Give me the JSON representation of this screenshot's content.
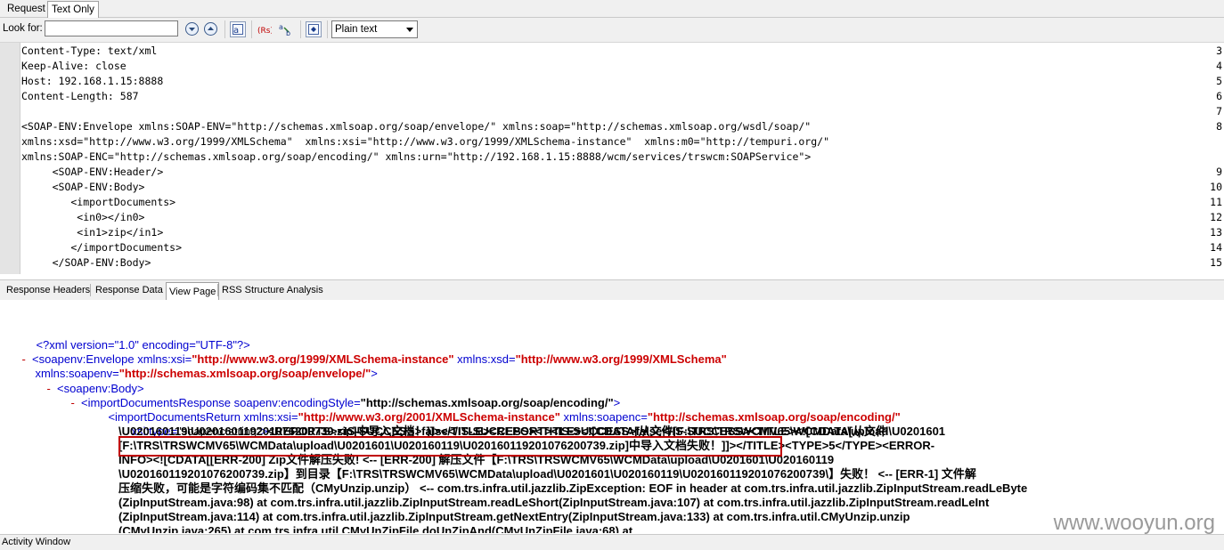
{
  "top_tabs": [
    "Request",
    "Text Only"
  ],
  "toolbar": {
    "look_for_label": "Look for:",
    "search_value": "",
    "search_placeholder": "",
    "format_selected": "Plain text"
  },
  "request_lines": [
    {
      "n": "3",
      "text": "Content-Type: text/xml"
    },
    {
      "n": "4",
      "text": "Keep-Alive: close"
    },
    {
      "n": "5",
      "text": "Host: 192.168.1.15:8888"
    },
    {
      "n": "6",
      "text": "Content-Length: 587"
    },
    {
      "n": "7",
      "text": ""
    },
    {
      "n": "8",
      "text": "<SOAP-ENV:Envelope xmlns:SOAP-ENV=\"http://schemas.xmlsoap.org/soap/envelope/\" xmlns:soap=\"http://schemas.xmlsoap.org/wsdl/soap/\""
    },
    {
      "n": "",
      "text": "xmlns:xsd=\"http://www.w3.org/1999/XMLSchema\"  xmlns:xsi=\"http://www.w3.org/1999/XMLSchema-instance\"  xmlns:m0=\"http://tempuri.org/\""
    },
    {
      "n": "",
      "text": "xmlns:SOAP-ENC=\"http://schemas.xmlsoap.org/soap/encoding/\" xmlns:urn=\"http://192.168.1.15:8888/wcm/services/trswcm:SOAPService\">"
    },
    {
      "n": "9",
      "text": "     <SOAP-ENV:Header/>"
    },
    {
      "n": "10",
      "text": "     <SOAP-ENV:Body>"
    },
    {
      "n": "11",
      "text": "        <importDocuments>"
    },
    {
      "n": "12",
      "text": "         <in0></in0>"
    },
    {
      "n": "13",
      "text": "         <in1>zip</in1>"
    },
    {
      "n": "14",
      "text": "        </importDocuments>"
    },
    {
      "n": "15",
      "text": "     </SOAP-ENV:Body>"
    }
  ],
  "response_tabs": [
    "Response Headers",
    "Response Data",
    "View Page",
    "RSS Structure Analysis"
  ],
  "xml": {
    "decl": "<?xml version=\"1.0\" encoding=\"UTF-8\"?>",
    "minus": "-",
    "env_open": "<soapenv:Envelope ",
    "xsi_attr": "xmlns:xsi=",
    "xsi_val": "\"http://www.w3.org/1999/XMLSchema-instance\"",
    "xsd_attr": " xmlns:xsd=",
    "xsd_val": "\"http://www.w3.org/1999/XMLSchema\"",
    "soapenv_attr": "xmlns:soapenv=",
    "soapenv_val": "\"http://schemas.xmlsoap.org/soap/envelope/\"",
    "gt": ">",
    "body_open": "<soapenv:Body>",
    "idr_open": "<importDocumentsResponse soapenv:encodingStyle=",
    "idr_val": "\"http://schemas.xmlsoap.org/soap/encoding/\"",
    "ret_open": "<importDocumentsReturn ",
    "ret_xsi_attr": "xmlns:xsi=",
    "ret_xsi_val": "\"http://www.w3.org/2001/XMLSchema-instance\"",
    "ret_enc_attr": " xmlns:soapenc=",
    "ret_enc_val": "\"http://schemas.xmlsoap.org/soap/encoding/\"",
    "type_attr": "xsi:type=",
    "type_val": "\"soapenc:string\"",
    "content_1": "<REPORTS><IS-SUCCESS>false</IS-SUCCESS><TITLE><![CDATA[从文件[F:\\TRS\\TRSWCMV65\\WCMData\\upload\\U0201601",
    "content_2": "\\U020160119\\U020160119201076200739.zip]中导入文档！]]></TITLE><REPORT><IS-SUCCESS>false</IS-SUCCESS><TITLE><![CDATA[从文件",
    "content_3": "[F:\\TRS\\TRSWCMV65\\WCMData\\upload\\U0201601\\U020160119\\U020160119201076200739.zip]中导入文档失败！]]></TITLE><TYPE>5</TYPE><ERROR-",
    "content_4": "INFO><![CDATA[[ERR-200] Zip文件解压失败! <-- [ERR-200] 解压文件【F:\\TRS\\TRSWCMV65\\WCMData\\upload\\U0201601\\U020160119",
    "content_5": "\\U020160119201076200739.zip】到目录【F:\\TRS\\TRSWCMV65\\WCMData\\upload\\U0201601\\U020160119\\U020160119201076200739\\】失败！ <-- [ERR-1] 文件解",
    "content_6": "压缩失败，可能是字符编码集不匹配（CMyUnzip.unzip） <-- com.trs.infra.util.jazzlib.ZipException: EOF in header at com.trs.infra.util.jazzlib.ZipInputStream.readLeByte",
    "content_7": "(ZipInputStream.java:98) at com.trs.infra.util.jazzlib.ZipInputStream.readLeShort(ZipInputStream.java:107) at com.trs.infra.util.jazzlib.ZipInputStream.readLeInt",
    "content_8": "(ZipInputStream.java:114) at com.trs.infra.util.jazzlib.ZipInputStream.getNextEntry(ZipInputStream.java:133) at com.trs.infra.util.CMyUnzip.unzip",
    "content_9": "(CMyUnzip.java:265) at com.trs.infra.util.CMyUnZipFile.doUnZipAnd(CMyUnZipFile.java:68) at"
  },
  "status": {
    "activity_window": "Activity Window"
  },
  "watermark": "www.wooyun.org",
  "colors": {
    "attr_value": "#cc0000",
    "tag": "#0000d0",
    "toggle": "#c00000"
  }
}
